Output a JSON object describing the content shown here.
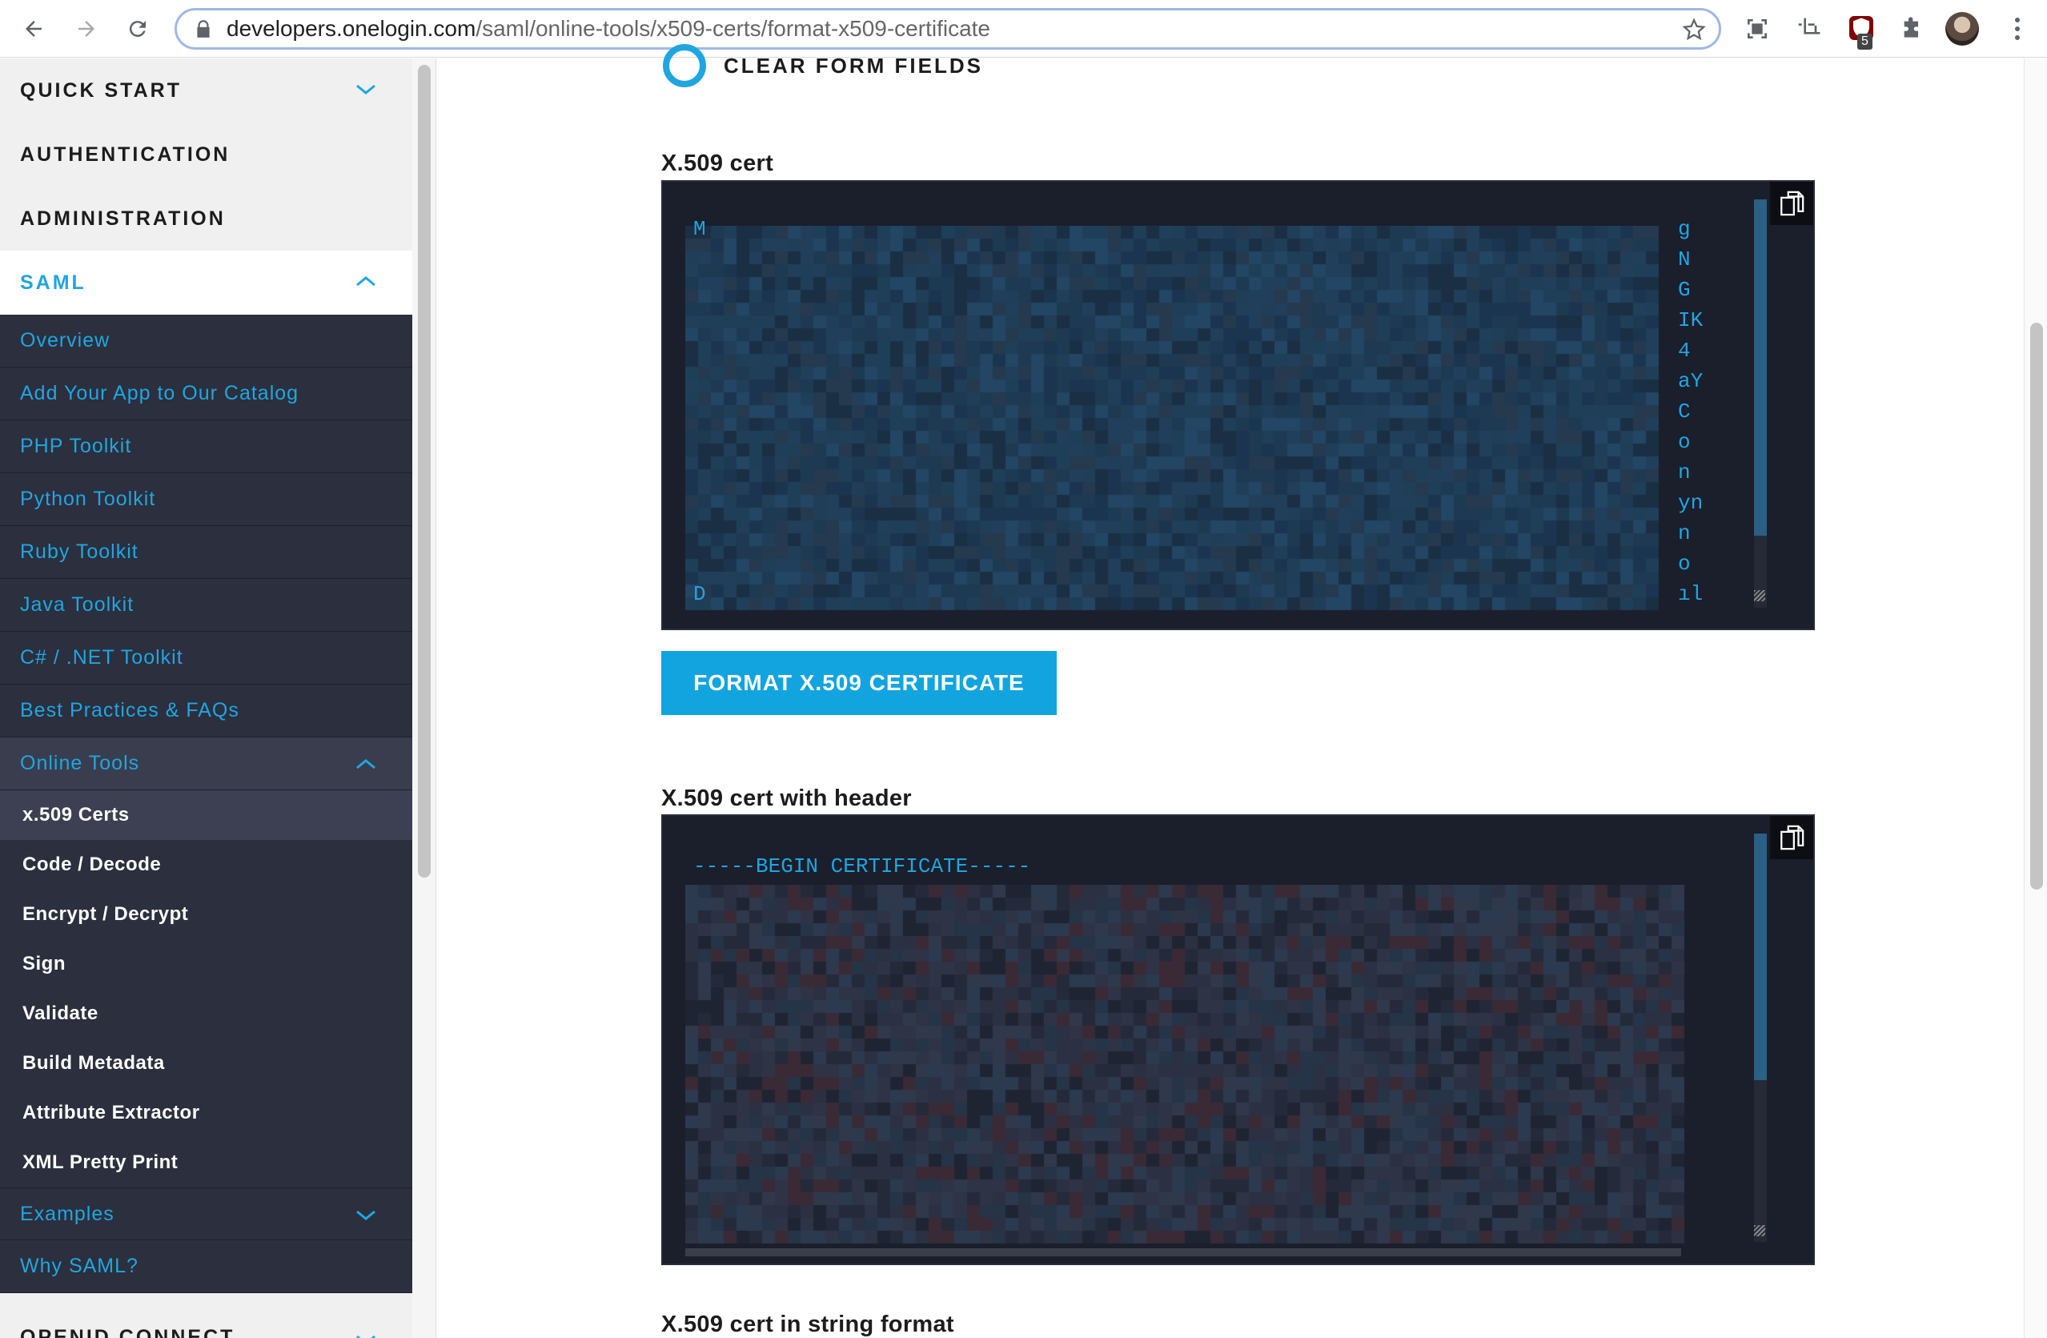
{
  "browser": {
    "url_host": "developers.onelogin.com",
    "url_path": "/saml/online-tools/x509-certs/format-x509-certificate",
    "extension_badge": "5"
  },
  "sidebar": {
    "top_items": [
      {
        "label": "QUICK START"
      },
      {
        "label": "AUTHENTICATION"
      },
      {
        "label": "ADMINISTRATION"
      },
      {
        "label": "SAML"
      }
    ],
    "saml_items": [
      {
        "label": "Overview"
      },
      {
        "label": "Add Your App to Our Catalog"
      },
      {
        "label": "PHP Toolkit"
      },
      {
        "label": "Python Toolkit"
      },
      {
        "label": "Ruby Toolkit"
      },
      {
        "label": "Java Toolkit"
      },
      {
        "label": "C# / .NET Toolkit"
      },
      {
        "label": "Best Practices & FAQs"
      },
      {
        "label": "Online Tools"
      }
    ],
    "tools": [
      {
        "label": "x.509 Certs"
      },
      {
        "label": "Code / Decode"
      },
      {
        "label": "Encrypt / Decrypt"
      },
      {
        "label": "Sign"
      },
      {
        "label": "Validate"
      },
      {
        "label": "Build Metadata"
      },
      {
        "label": "Attribute Extractor"
      },
      {
        "label": "XML Pretty Print"
      }
    ],
    "after_items": [
      {
        "label": "Examples"
      },
      {
        "label": "Why SAML?"
      }
    ],
    "bottom_item": "OPENID CONNECT"
  },
  "main": {
    "clear_label": "CLEAR FORM FIELDS",
    "cert_label": "X.509 cert",
    "cert_left_chars": [
      "M",
      "D"
    ],
    "cert_right_chars": [
      "g",
      "N",
      "G",
      "IK",
      "4",
      "aY",
      "C",
      "o",
      "n",
      "yn",
      "n",
      "o",
      "ıl"
    ],
    "format_button": "FORMAT X.509 CERTIFICATE",
    "cert_header_label": "X.509 cert with header",
    "begin_line": "-----BEGIN CERTIFICATE-----",
    "cert_string_label": "X.509 cert in string format"
  },
  "colors": {
    "accent": "#1fa6e1",
    "sidebar_dark": "#2c2f3d",
    "textarea_bg": "#1b1e2b",
    "button": "#12a4df"
  }
}
